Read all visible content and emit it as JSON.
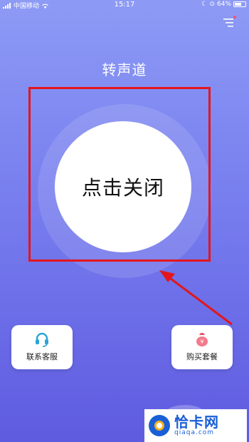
{
  "status_bar": {
    "carrier": "中国移动",
    "time": "15:17",
    "battery_percent": "64%",
    "battery_level": 0.64
  },
  "header": {
    "title": "转声道"
  },
  "main_button": {
    "label": "点击关闭"
  },
  "cards": {
    "left": {
      "label": "联系客服",
      "icon": "headset-icon"
    },
    "right": {
      "label": "购买套餐",
      "icon": "money-bag-icon"
    }
  },
  "annotation": {
    "box_color": "#e3161c",
    "arrow_color": "#e3161c"
  },
  "watermark": {
    "name": "恰卡网",
    "url": "qiaqa.com"
  },
  "colors": {
    "background_top": "#8d9bf5",
    "background_bottom": "#5f5be0"
  }
}
